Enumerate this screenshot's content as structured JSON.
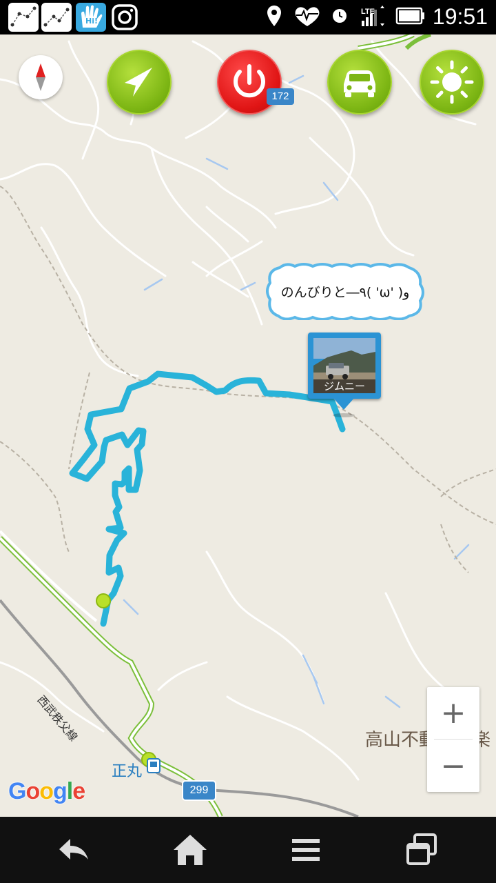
{
  "status_bar": {
    "time": "19:51",
    "network": "LTE",
    "left_icons": [
      "constellation-icon",
      "constellation-icon",
      "hi-app-icon",
      "instagram-icon"
    ],
    "right_icons": [
      "location-pin-icon",
      "heart-monitor-icon",
      "alarm-clock-icon",
      "signal-icon",
      "battery-icon"
    ]
  },
  "toolbar": {
    "buttons": [
      {
        "name": "navigate-button",
        "icon": "navigation-arrow-icon",
        "color": "#7db614"
      },
      {
        "name": "power-button",
        "icon": "power-icon",
        "color": "#e01515"
      },
      {
        "name": "car-button",
        "icon": "car-icon",
        "color": "#7db614"
      },
      {
        "name": "brightness-button",
        "icon": "sun-icon",
        "color": "#7db614"
      }
    ],
    "compass_icon": "compass-icon"
  },
  "map": {
    "speech_bubble": "のんびりと―٩( 'ω' )و",
    "photo_marker_label": "ジムニー",
    "place_label": "高山不動尊常楽",
    "station_label": "正丸",
    "rail_label": "西武秩父線",
    "road_shields": [
      "172",
      "299"
    ],
    "attribution": "Google",
    "route_color": "#29b3d9",
    "zoom_in": "+",
    "zoom_out": "−"
  },
  "nav_bar": {
    "icons": [
      "back-icon",
      "home-icon",
      "menu-icon",
      "recent-apps-icon"
    ]
  }
}
